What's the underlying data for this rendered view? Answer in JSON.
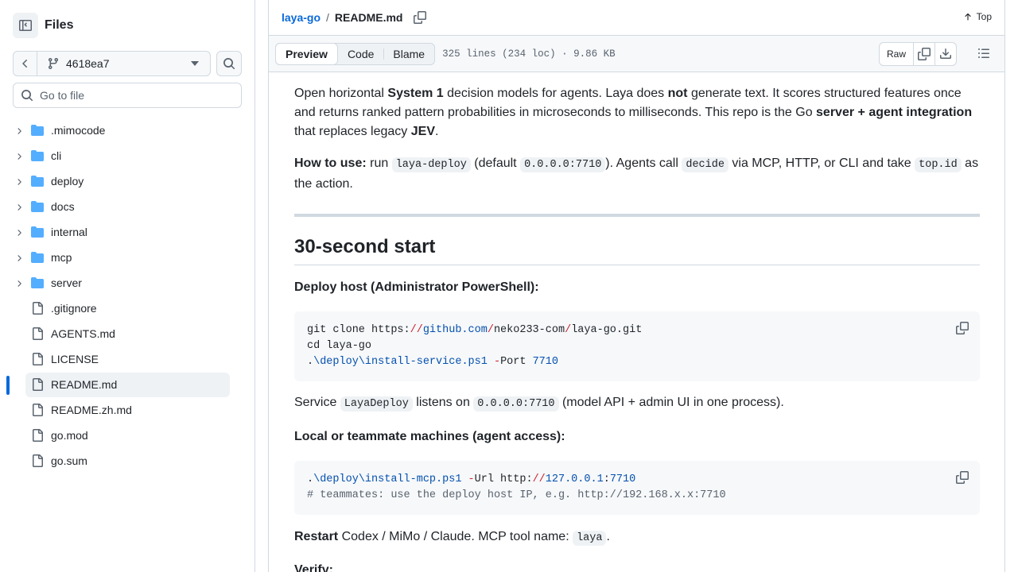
{
  "sidebar": {
    "title": "Files",
    "branch": "4618ea7",
    "goto_placeholder": "Go to file",
    "items": [
      {
        "label": ".mimocode",
        "type": "folder"
      },
      {
        "label": "cli",
        "type": "folder"
      },
      {
        "label": "deploy",
        "type": "folder"
      },
      {
        "label": "docs",
        "type": "folder"
      },
      {
        "label": "internal",
        "type": "folder"
      },
      {
        "label": "mcp",
        "type": "folder"
      },
      {
        "label": "server",
        "type": "folder"
      },
      {
        "label": ".gitignore",
        "type": "file"
      },
      {
        "label": "AGENTS.md",
        "type": "file"
      },
      {
        "label": "LICENSE",
        "type": "file"
      },
      {
        "label": "README.md",
        "type": "file",
        "active": true
      },
      {
        "label": "README.zh.md",
        "type": "file"
      },
      {
        "label": "go.mod",
        "type": "file"
      },
      {
        "label": "go.sum",
        "type": "file"
      }
    ]
  },
  "header": {
    "repo": "laya-go",
    "separator": "/",
    "file": "README.md",
    "top_label": "Top"
  },
  "filebar": {
    "tabs": [
      "Preview",
      "Code",
      "Blame"
    ],
    "meta": "325 lines (234 loc) · 9.86 KB",
    "raw_label": "Raw"
  },
  "readme": {
    "intro": {
      "t1": "Open horizontal ",
      "b1": "System 1",
      "t2": " decision models for agents. Laya does ",
      "b2": "not",
      "t3": " generate text. It scores structured features once and returns ranked pattern probabilities in microseconds to milliseconds. This repo is the Go ",
      "b3": "server + agent integration",
      "t4": " that replaces legacy ",
      "b4": "JEV",
      "t5": "."
    },
    "howto": {
      "b1": "How to use:",
      "t1": " run ",
      "c1": "laya-deploy",
      "t2": " (default ",
      "c2": "0.0.0.0:7710",
      "t3": "). Agents call ",
      "c3": "decide",
      "t4": " via MCP, HTTP, or CLI and take ",
      "c4": "top.id",
      "t5": " as the action."
    },
    "h2": "30-second start",
    "deploy_heading": "Deploy host (Administrator PowerShell):",
    "code1": {
      "l1a": "git clone https:",
      "l1b": "//",
      "l1c": "github.com",
      "l1d": "/",
      "l1e": "neko233-com",
      "l1f": "/",
      "l1g": "laya-go.git",
      "l2": "cd laya-go",
      "l3a": ".",
      "l3b": "\\deploy\\install-service.ps1",
      "l3c": " -",
      "l3d": "Port ",
      "l3e": "7710"
    },
    "service": {
      "t1": "Service ",
      "c1": "LayaDeploy",
      "t2": " listens on ",
      "c2": "0.0.0.0:7710",
      "t3": " (model API + admin UI in one process)."
    },
    "local_heading": "Local or teammate machines (agent access):",
    "code2": {
      "l1a": ".",
      "l1b": "\\deploy\\install-mcp.ps1",
      "l1c": " -",
      "l1d": "Url http:",
      "l1e": "//",
      "l1f": "127.0.0.1",
      "l1g": ":",
      "l1h": "7710",
      "l2": "# teammates: use the deploy host IP, e.g. http://192.168.x.x:7710"
    },
    "restart": {
      "b1": "Restart",
      "t1": " Codex / MiMo / Claude. MCP tool name: ",
      "c1": "laya",
      "t2": "."
    },
    "verify": "Verify:"
  }
}
